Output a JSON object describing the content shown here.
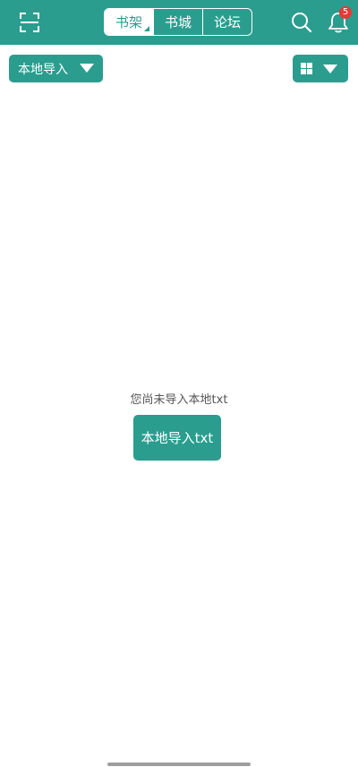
{
  "header": {
    "tabs": [
      {
        "label": "书架",
        "active": true
      },
      {
        "label": "书城",
        "active": false
      },
      {
        "label": "论坛",
        "active": false
      }
    ],
    "notification_count": "5",
    "icons": {
      "scan": "scan-icon",
      "search": "search-icon",
      "notification": "notification-icon"
    }
  },
  "toolbar": {
    "import_dropdown_label": "本地导入",
    "view_icon": "grid-view-icon"
  },
  "main": {
    "empty_message": "您尚未导入本地txt",
    "import_button_label": "本地导入txt"
  },
  "colors": {
    "accent": "#2a9d8f",
    "badge": "#e53935",
    "background": "#ffffff"
  }
}
